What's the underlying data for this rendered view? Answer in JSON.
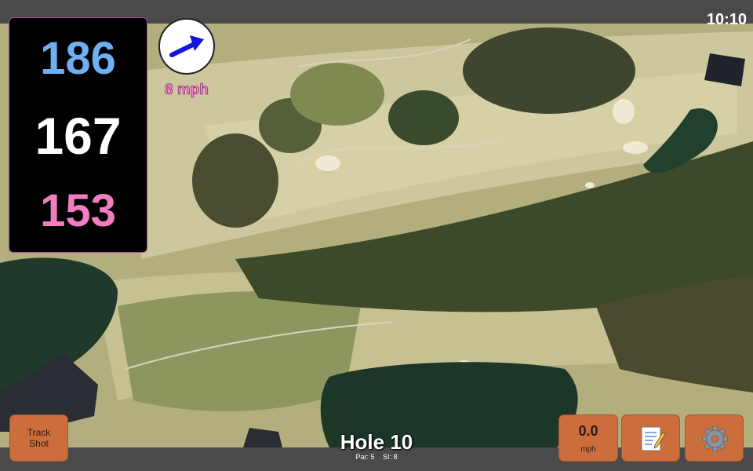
{
  "status_bar": {
    "time": "10:10"
  },
  "distances": {
    "back": "186",
    "center": "167",
    "front": "153"
  },
  "wind": {
    "speed": "8 mph",
    "icon": "wind-arrow-icon"
  },
  "buttons": {
    "track_shot_line1": "Track",
    "track_shot_line2": "Shot",
    "speed_value": "0.0",
    "speed_unit": "mph",
    "notes_icon": "notepad-icon",
    "settings_icon": "gear-icon"
  },
  "hole": {
    "title": "Hole 10",
    "par": "Par: 5",
    "si": "SI: 8"
  },
  "colors": {
    "back_distance": "#6fb0f3",
    "center_distance": "#ffffff",
    "front_distance": "#f07ec0",
    "wind_text": "#ff7fd8",
    "button": "#cc6e3c",
    "fairway": "#c8c49a",
    "rough": "#a8a878",
    "water": "#1f3a2a",
    "trees": "#3d4a2a"
  }
}
